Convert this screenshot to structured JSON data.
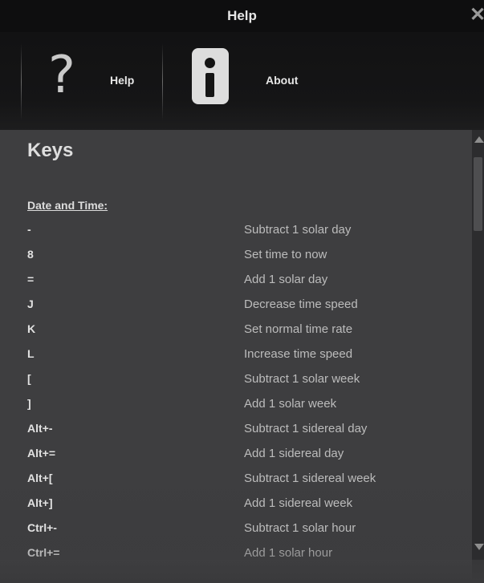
{
  "window": {
    "title": "Help",
    "close_glyph": "✕"
  },
  "toolbar": {
    "help": {
      "label": "Help",
      "icon_glyph": "?",
      "icon": "question-mark-icon"
    },
    "about": {
      "label": "About",
      "icon": "info-icon"
    }
  },
  "content": {
    "heading": "Keys",
    "section_title": "Date and Time:",
    "shortcuts": [
      {
        "key": "-",
        "description": "Subtract 1 solar day"
      },
      {
        "key": "8",
        "description": "Set time to now"
      },
      {
        "key": "=",
        "description": "Add 1 solar day"
      },
      {
        "key": "J",
        "description": "Decrease time speed"
      },
      {
        "key": "K",
        "description": "Set normal time rate"
      },
      {
        "key": "L",
        "description": "Increase time speed"
      },
      {
        "key": "[",
        "description": "Subtract 1 solar week"
      },
      {
        "key": "]",
        "description": "Add 1 solar week"
      },
      {
        "key": "Alt+-",
        "description": "Subtract 1 sidereal day"
      },
      {
        "key": "Alt+=",
        "description": "Add 1 sidereal day"
      },
      {
        "key": "Alt+[",
        "description": "Subtract 1 sidereal week"
      },
      {
        "key": "Alt+]",
        "description": "Add 1 sidereal week"
      },
      {
        "key": "Ctrl+-",
        "description": "Subtract 1 solar hour"
      },
      {
        "key": "Ctrl+=",
        "description": "Add 1 solar hour"
      }
    ]
  }
}
